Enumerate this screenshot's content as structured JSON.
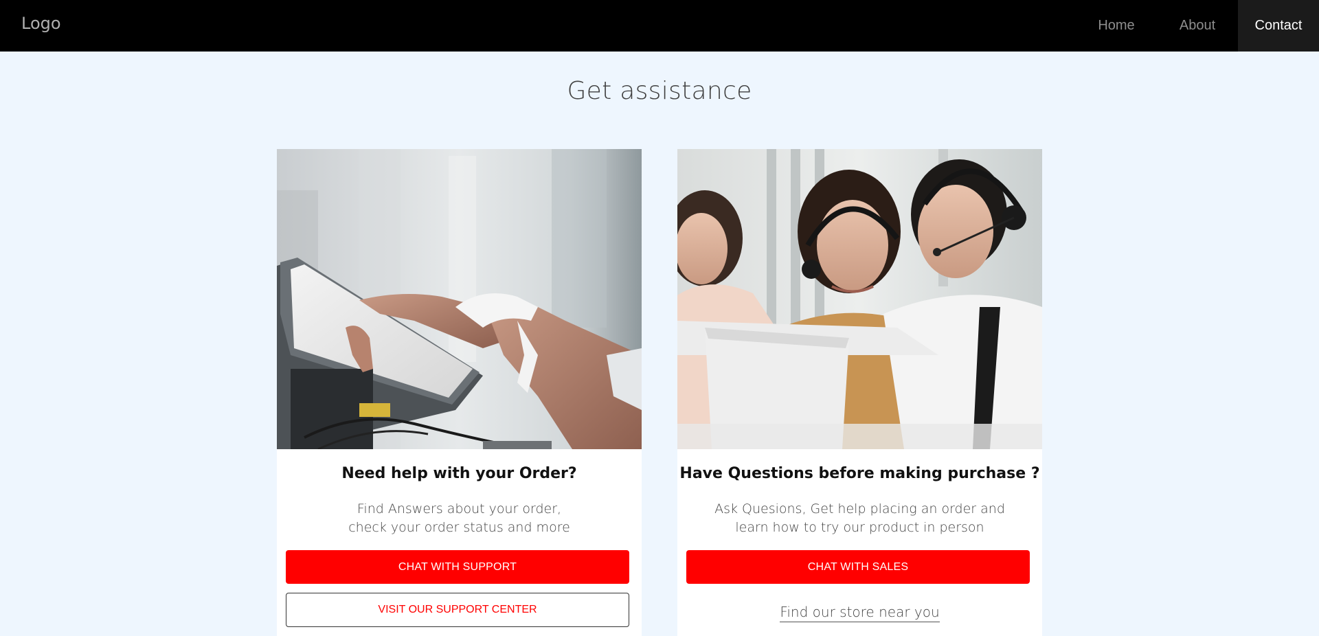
{
  "navbar": {
    "logo": "Logo",
    "links": [
      {
        "label": "Home",
        "active": false
      },
      {
        "label": "About",
        "active": false
      },
      {
        "label": "Contact",
        "active": true
      }
    ]
  },
  "page": {
    "title": "Get assistance"
  },
  "cards": [
    {
      "image": "photo-touchscreen-pos-terminal",
      "heading": "Need help with your Order?",
      "text_line1": "Find Answers about your order,",
      "text_line2": "check your order status and more",
      "primary_button": "CHAT WITH SUPPORT",
      "secondary_button": "VISIT OUR SUPPORT CENTER"
    },
    {
      "image": "photo-call-center-agents-with-headsets",
      "heading": "Have Questions before making purchase ?",
      "text_line1": "Ask Quesions, Get help placing an order and",
      "text_line2": "learn how to try our product in person",
      "primary_button": "CHAT WITH SALES",
      "link": "Find our store near you"
    }
  ],
  "colors": {
    "accent": "#ff0000",
    "navbar_bg": "#000000",
    "page_bg": "#eef6fe",
    "active_nav_bg": "#1b1b1b"
  }
}
